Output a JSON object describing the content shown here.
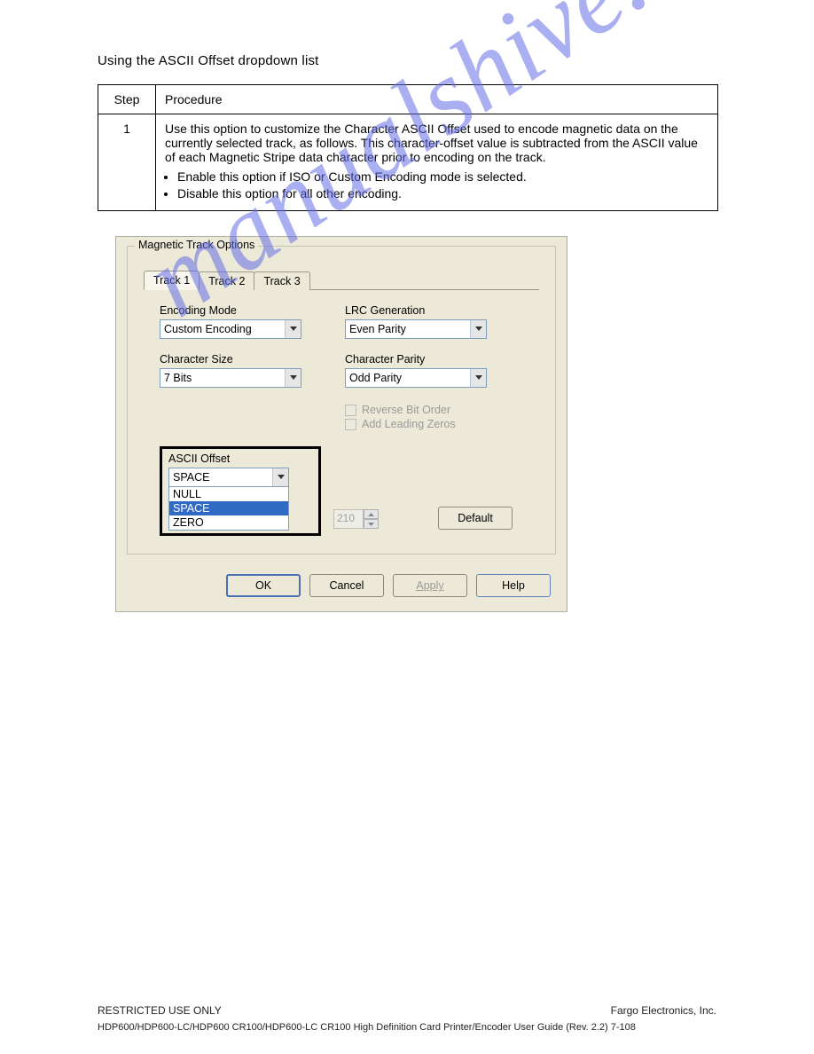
{
  "page_title": "Using the ASCII Offset dropdown list",
  "table": {
    "header": {
      "step": "Step",
      "procedure": "Procedure"
    },
    "row": {
      "step": "1",
      "intro": "Use this option to customize the Character ASCII Offset used to encode magnetic data on the currently selected track, as follows. This character-offset value is subtracted from the ASCII value of each Magnetic Stripe data character prior to encoding on the track.",
      "bullets": [
        "Enable this option if ISO or Custom Encoding mode is selected.",
        "Disable this option for all other encoding."
      ]
    }
  },
  "dialog": {
    "group_title": "Magnetic Track Options",
    "tabs": [
      "Track 1",
      "Track 2",
      "Track 3"
    ],
    "active_tab": 0,
    "fields": {
      "encoding_mode": {
        "label": "Encoding Mode",
        "value": "Custom Encoding"
      },
      "lrc_generation": {
        "label": "LRC Generation",
        "value": "Even Parity"
      },
      "character_size": {
        "label": "Character Size",
        "value": "7 Bits"
      },
      "character_parity": {
        "label": "Character Parity",
        "value": "Odd Parity"
      },
      "ascii_offset": {
        "label": "ASCII Offset",
        "value": "SPACE",
        "options": [
          "NULL",
          "SPACE",
          "ZERO"
        ]
      },
      "reverse_bit_order": {
        "label": "Reverse Bit Order",
        "enabled": false,
        "checked": false
      },
      "add_leading_zeros": {
        "label": "Add Leading Zeros",
        "enabled": false,
        "checked": false
      },
      "bit_density_value": "210"
    },
    "buttons": {
      "default": "Default",
      "ok": "OK",
      "cancel": "Cancel",
      "apply": "Apply",
      "help": "Help"
    }
  },
  "footer_left": "RESTRICTED USE ONLY",
  "footer_right": "Fargo Electronics, Inc.",
  "doc_id_line": "HDP600/HDP600-LC/HDP600 CR100/HDP600-LC CR100 High Definition Card Printer/Encoder User Guide (Rev. 2.2) 7-108",
  "watermark": "manualshive.com"
}
